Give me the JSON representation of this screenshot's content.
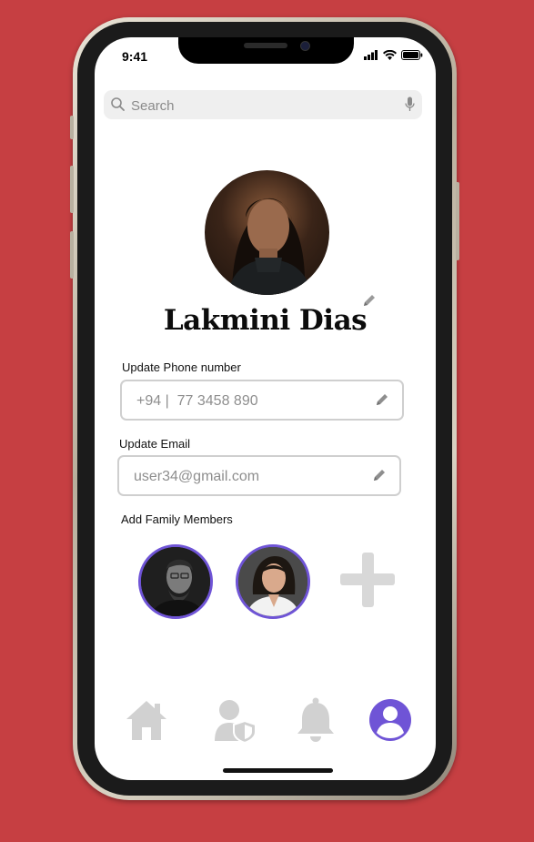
{
  "status_bar": {
    "time": "9:41"
  },
  "search": {
    "placeholder": "Search"
  },
  "profile": {
    "name": "Lakmini Dias"
  },
  "phone_field": {
    "label": "Update Phone number",
    "value": "+94 |  77 3458 890"
  },
  "email_field": {
    "label": "Update Email",
    "value": "user34@gmail.com"
  },
  "family": {
    "label": "Add Family Members"
  },
  "tabs": [
    "home-icon",
    "user-shield-icon",
    "bell-icon",
    "profile-icon"
  ],
  "colors": {
    "accent": "#6f54d6",
    "background": "#c63f42",
    "inactive": "#d1d1d1"
  }
}
